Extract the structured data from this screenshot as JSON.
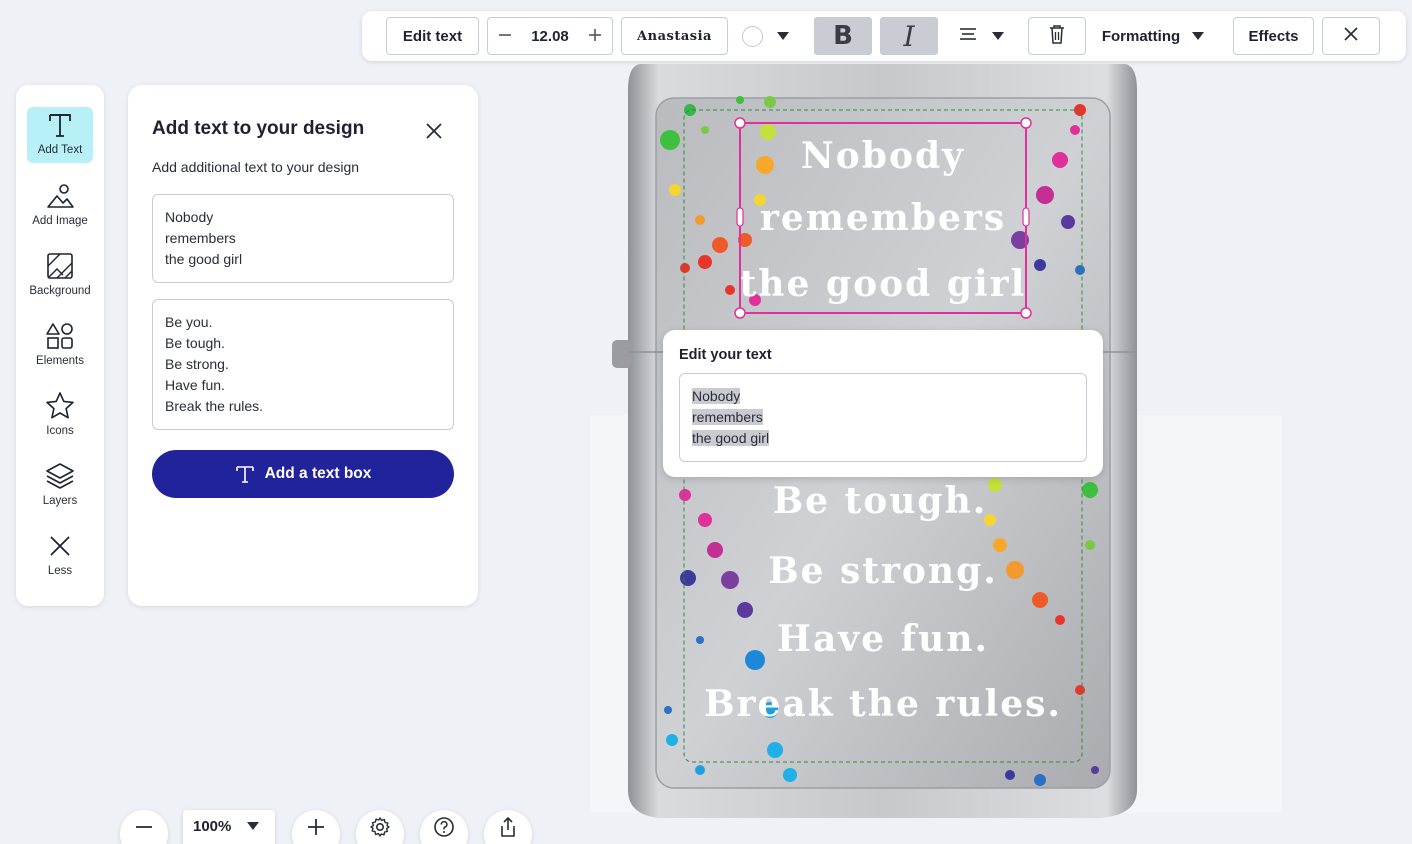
{
  "toolbar": {
    "edit_text_label": "Edit text",
    "font_size": "12.08",
    "font_name": "Anastasia",
    "bold_label": "B",
    "italic_label": "I",
    "formatting_label": "Formatting",
    "effects_label": "Effects",
    "text_color": "#ffffff",
    "icons": [
      "minus-icon",
      "plus-icon",
      "color-swatch",
      "chevron-down-icon",
      "align-center-icon",
      "trash-icon",
      "close-icon"
    ]
  },
  "sidebar": {
    "items": [
      {
        "label": "Add Text",
        "icon": "text-icon",
        "active": true
      },
      {
        "label": "Add Image",
        "icon": "image-icon"
      },
      {
        "label": "Background",
        "icon": "background-icon"
      },
      {
        "label": "Elements",
        "icon": "shapes-icon"
      },
      {
        "label": "Icons",
        "icon": "star-icon"
      },
      {
        "label": "Layers",
        "icon": "layers-icon"
      },
      {
        "label": "Less",
        "icon": "close-icon"
      }
    ]
  },
  "panel": {
    "title": "Add text to your design",
    "subtitle": "Add additional text to your design",
    "text_boxes": [
      {
        "lines": [
          "Nobody",
          "remembers",
          "the good girl"
        ]
      },
      {
        "lines": [
          "Be you.",
          "Be tough.",
          "Be strong.",
          "Have fun.",
          "Break the rules."
        ]
      }
    ],
    "add_button_label": "Add a text box",
    "accent_color": "#21239b"
  },
  "canvas": {
    "headline_lines": [
      "Nobody",
      "remembers",
      "the good girl"
    ],
    "body_lines_visible": [
      "Be tough.",
      "Be strong.",
      "Have fun.",
      "Break the rules."
    ],
    "selection_color": "#e0309c"
  },
  "edit_popup": {
    "title": "Edit your text",
    "lines": [
      "Nobody",
      "remembers",
      "the good girl"
    ]
  },
  "bottom_bar": {
    "zoom_level": "100%"
  }
}
